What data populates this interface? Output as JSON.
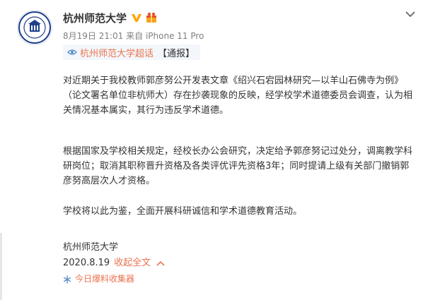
{
  "post": {
    "author": "杭州师范大学",
    "time": "8月19日 21:01",
    "via": "来自 iPhone 11 Pro",
    "topic_link": "杭州师范大学超话",
    "tag": "【通报】",
    "paragraphs": [
      "对近期关于我校教师郭彦努公开发表文章《绍兴石宕园林研究—以羊山石佛寺为例》（论文署名单位非杭师大）存在抄袭现象的反映，经学校学术道德委员会调查，认为相关情况基本属实，其行为违反学术道德。",
      "根据国家及学校相关规定，经校长办公会研究，决定给予郭彦努记过处分，调离教学科研岗位；取消其职称晋升资格及各类评优评先资格3年；同时提请上级有关部门撤销郭彦努高层次人才资格。",
      "学校将以此为鉴，全面开展科研诚信和学术道德教育活动。"
    ],
    "signature": "杭州师范大学",
    "date": "2020.8.19",
    "collapse_label": "收起全文",
    "source_label": "今日爆料收集器"
  },
  "colors": {
    "link": "#eb7350",
    "verified": "#ffa500",
    "topic_bg": "#f3f7fb",
    "text": "#333333",
    "meta": "#808080"
  },
  "icons": [
    "avatar-emblem",
    "verified-badge-icon",
    "membership-badge-icon",
    "chevron-down-icon",
    "topic-icon",
    "caret-up-icon",
    "snowflake-icon"
  ]
}
